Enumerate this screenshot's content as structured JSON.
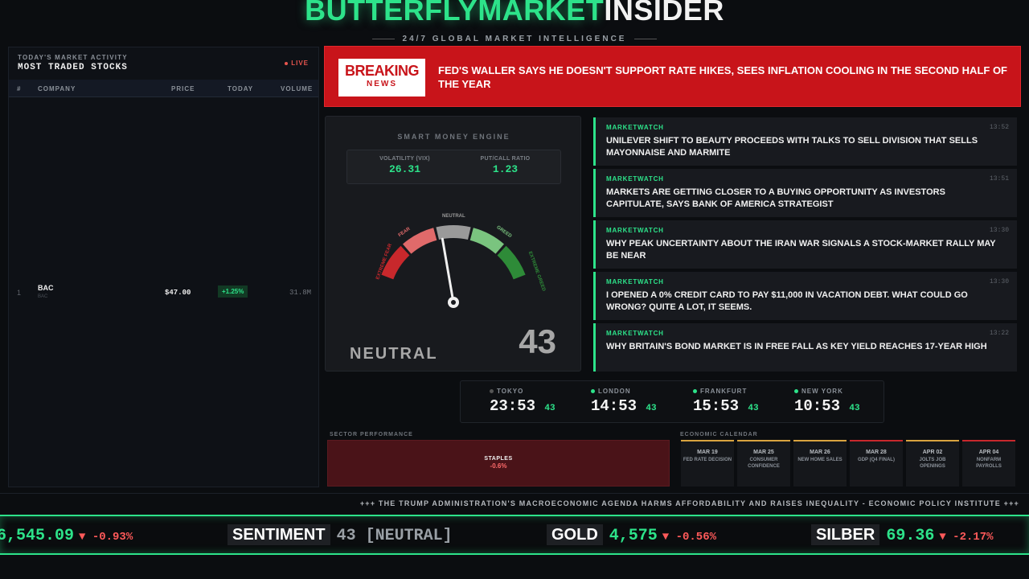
{
  "header": {
    "brand_part1": "BUTTERFLYMARKET",
    "brand_part2": "INSIDER",
    "tagline": "24/7 GLOBAL MARKET INTELLIGENCE"
  },
  "stocks": {
    "subtitle": "TODAY'S MARKET ACTIVITY",
    "title": "MOST TRADED STOCKS",
    "live_label": "LIVE",
    "columns": [
      "#",
      "COMPANY",
      "PRICE",
      "TODAY",
      "VOLUME"
    ],
    "rows": [
      {
        "rank": "1",
        "ticker": "BAC",
        "sub": "BAC",
        "price": "$47.00",
        "today": "+1.25%",
        "volume": "31.8M"
      }
    ]
  },
  "breaking": {
    "badge_line1": "BREAKING",
    "badge_line2": "NEWS",
    "headline": "FED'S WALLER SAYS HE DOESN'T SUPPORT RATE HIKES, SEES INFLATION COOLING IN THE SECOND HALF OF THE YEAR"
  },
  "engine": {
    "title": "SMART MONEY ENGINE",
    "vix_label": "VOLATILITY (VIX)",
    "vix_value": "26.31",
    "pc_label": "PUT/CALL RATIO",
    "pc_value": "1.23",
    "gauge_labels": {
      "extreme_fear": "EXTREME FEAR",
      "fear": "FEAR",
      "neutral": "NEUTRAL",
      "greed": "GREED",
      "extreme_greed": "EXTREME GREED"
    },
    "gauge_value": 43,
    "state": "NEUTRAL",
    "score": "43",
    "colors": {
      "extreme_fear": "#c8282c",
      "fear": "#e06a6a",
      "neutral": "#9a9a9a",
      "greed": "#7ac47f",
      "extreme_greed": "#2e8b38"
    }
  },
  "news": [
    {
      "source": "MARKETWATCH",
      "time": "13:52",
      "headline": "UNILEVER SHIFT TO BEAUTY PROCEEDS WITH TALKS TO SELL DIVISION THAT SELLS MAYONNAISE AND MARMITE"
    },
    {
      "source": "MARKETWATCH",
      "time": "13:51",
      "headline": "MARKETS ARE GETTING CLOSER TO A BUYING OPPORTUNITY AS INVESTORS CAPITULATE, SAYS BANK OF AMERICA STRATEGIST"
    },
    {
      "source": "MARKETWATCH",
      "time": "13:30",
      "headline": "WHY PEAK UNCERTAINTY ABOUT THE IRAN WAR SIGNALS A STOCK-MARKET RALLY MAY BE NEAR"
    },
    {
      "source": "MARKETWATCH",
      "time": "13:30",
      "headline": "I OPENED A 0% CREDIT CARD TO PAY $11,000 IN VACATION DEBT. WHAT COULD GO WRONG? QUITE A LOT, IT SEEMS."
    },
    {
      "source": "MARKETWATCH",
      "time": "13:22",
      "headline": "WHY BRITAIN'S BOND MARKET IS IN FREE FALL AS KEY YIELD REACHES 17-YEAR HIGH"
    }
  ],
  "clocks": [
    {
      "city": "TOKYO",
      "time": "23:53",
      "sec": "43",
      "open": false
    },
    {
      "city": "LONDON",
      "time": "14:53",
      "sec": "43",
      "open": true
    },
    {
      "city": "FRANKFURT",
      "time": "15:53",
      "sec": "43",
      "open": true
    },
    {
      "city": "NEW YORK",
      "time": "10:53",
      "sec": "43",
      "open": true
    }
  ],
  "sector": {
    "label": "SECTOR PERFORMANCE",
    "name": "STAPLES",
    "change": "-0.6%"
  },
  "calendar": {
    "label": "ECONOMIC CALENDAR",
    "items": [
      {
        "date": "MAR 19",
        "event": "FED RATE DECISION"
      },
      {
        "date": "MAR 25",
        "event": "CONSUMER CONFIDENCE"
      },
      {
        "date": "MAR 26",
        "event": "NEW HOME SALES"
      },
      {
        "date": "MAR 28",
        "event": "GDP (Q4 FINAL)"
      },
      {
        "date": "APR 02",
        "event": "JOLTS JOB OPENINGS"
      },
      {
        "date": "APR 04",
        "event": "NONFARM PAYROLLS"
      }
    ]
  },
  "news_ticker": "+++ THE TRUMP ADMINISTRATION'S MACROECONOMIC AGENDA HARMS AFFORDABILITY AND RAISES INEQUALITY - ECONOMIC POLICY INSTITUTE +++",
  "price_ticker": {
    "first_value": "6,545.09",
    "first_change": "▼ -0.93%",
    "sentiment_label": "SENTIMENT",
    "sentiment_value": "43 [NEUTRAL]",
    "gold_label": "GOLD",
    "gold_value": "4,575",
    "gold_change": "▼ -0.56%",
    "silber_label": "SILBER",
    "silber_value": "69.36",
    "silber_change": "▼ -2.17%"
  }
}
